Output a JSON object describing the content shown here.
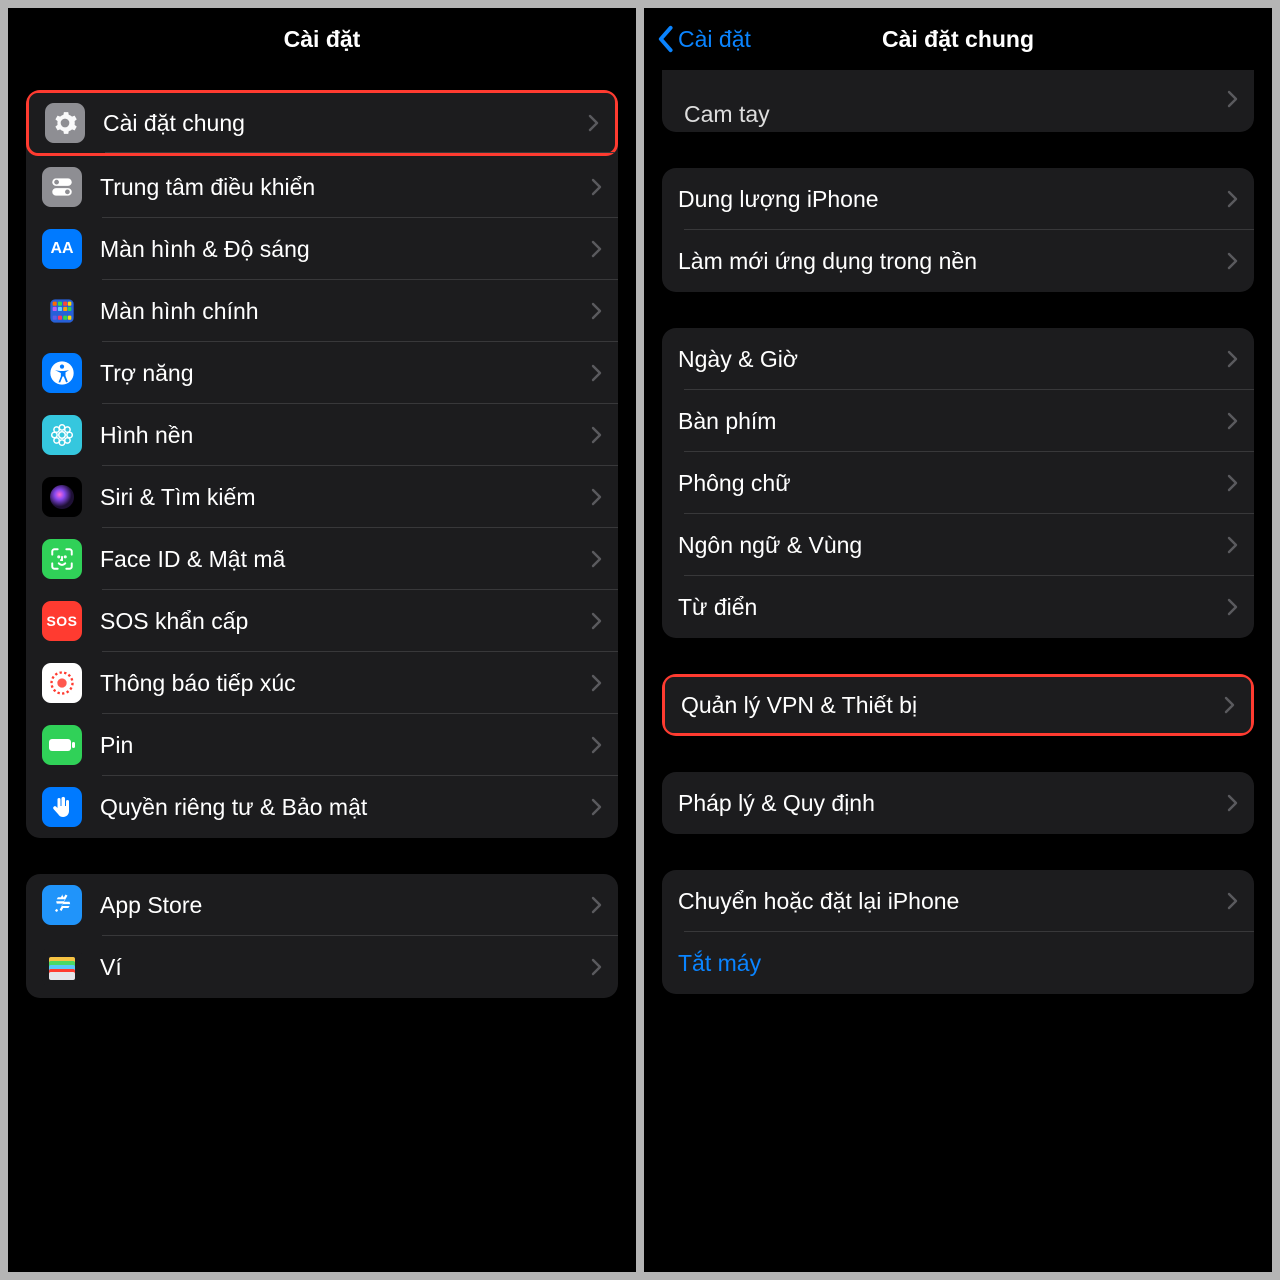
{
  "left": {
    "title": "Cài đặt",
    "groups": [
      {
        "first": true,
        "rows": [
          {
            "icon": "gear",
            "bg": "bg-gray",
            "label": "Cài đặt chung",
            "highlight": true
          },
          {
            "icon": "toggles",
            "bg": "bg-gray2",
            "label": "Trung tâm điều khiển"
          },
          {
            "icon": "AA",
            "bg": "bg-blue",
            "label": "Màn hình & Độ sáng"
          },
          {
            "icon": "grid",
            "bg": "bg-darkblue",
            "label": "Màn hình chính"
          },
          {
            "icon": "access",
            "bg": "bg-blue",
            "label": "Trợ năng"
          },
          {
            "icon": "flower",
            "bg": "bg-teal",
            "label": "Hình nền"
          },
          {
            "icon": "siri",
            "bg": "bg-black",
            "label": "Siri & Tìm kiếm"
          },
          {
            "icon": "faceid",
            "bg": "bg-green",
            "label": "Face ID & Mật mã"
          },
          {
            "icon": "SOS",
            "bg": "bg-red",
            "label": "SOS khẩn cấp"
          },
          {
            "icon": "exposure",
            "bg": "bg-white",
            "label": "Thông báo tiếp xúc"
          },
          {
            "icon": "battery",
            "bg": "bg-green2",
            "label": "Pin"
          },
          {
            "icon": "hand",
            "bg": "bg-blue",
            "label": "Quyền riêng tư & Bảo mật"
          }
        ]
      },
      {
        "rows": [
          {
            "icon": "appstore",
            "bg": "bg-bluebright",
            "label": "App Store"
          },
          {
            "icon": "wallet",
            "bg": "bg-black",
            "label": "Ví"
          }
        ]
      }
    ]
  },
  "right": {
    "back": "Cài đặt",
    "title": "Cài đặt chung",
    "partial": "Cam tay",
    "groups": [
      {
        "rows": [
          {
            "label": "Dung lượng iPhone"
          },
          {
            "label": "Làm mới ứng dụng trong nền"
          }
        ]
      },
      {
        "rows": [
          {
            "label": "Ngày & Giờ"
          },
          {
            "label": "Bàn phím"
          },
          {
            "label": "Phông chữ"
          },
          {
            "label": "Ngôn ngữ & Vùng"
          },
          {
            "label": "Từ điển"
          }
        ]
      },
      {
        "rows": [
          {
            "label": "Quản lý VPN & Thiết bị",
            "highlight": true
          }
        ]
      },
      {
        "rows": [
          {
            "label": "Pháp lý & Quy định"
          }
        ]
      },
      {
        "rows": [
          {
            "label": "Chuyển hoặc đặt lại iPhone"
          },
          {
            "label": "Tắt máy",
            "link": true,
            "nochev": true
          }
        ]
      }
    ]
  }
}
